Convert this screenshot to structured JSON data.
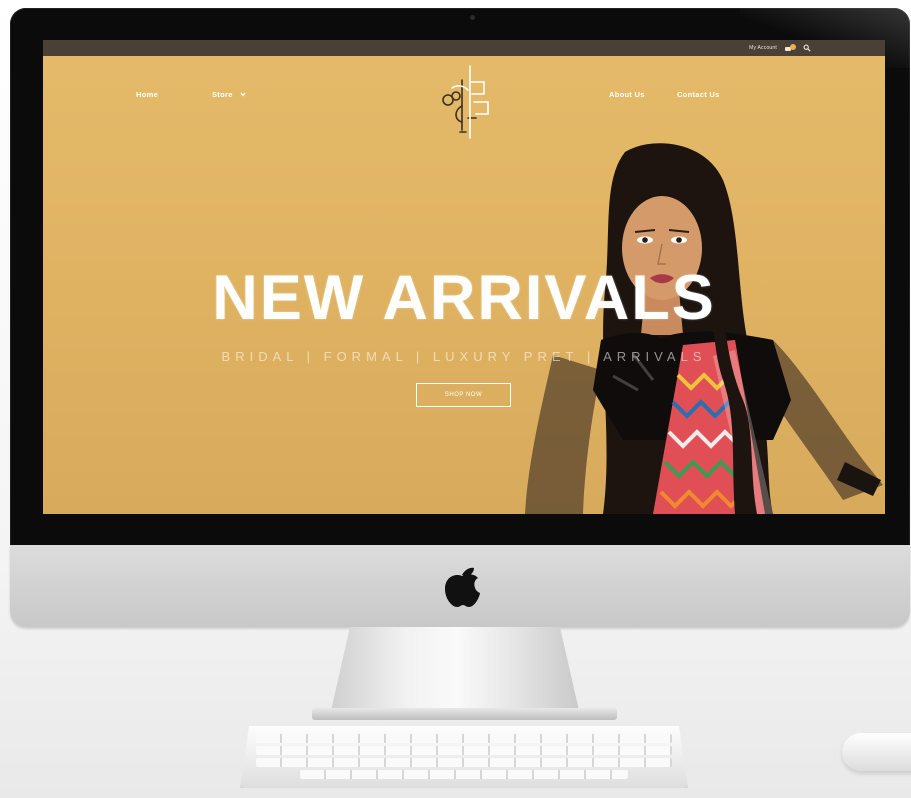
{
  "topbar": {
    "account_label": "My Account",
    "icons": [
      "cart-icon",
      "search-icon"
    ]
  },
  "nav": {
    "home": "Home",
    "store": "Store",
    "about": "About Us",
    "contact": "Contact Us"
  },
  "hero": {
    "title": "NEW ARRIVALS",
    "subtitle": "BRIDAL | FORMAL | LUXURY PRET | ARRIVALS",
    "button": "SHOP NOW"
  },
  "colors": {
    "hero_background": "#e0b464",
    "topbar": "#4a4036",
    "text": "#ffffff"
  }
}
